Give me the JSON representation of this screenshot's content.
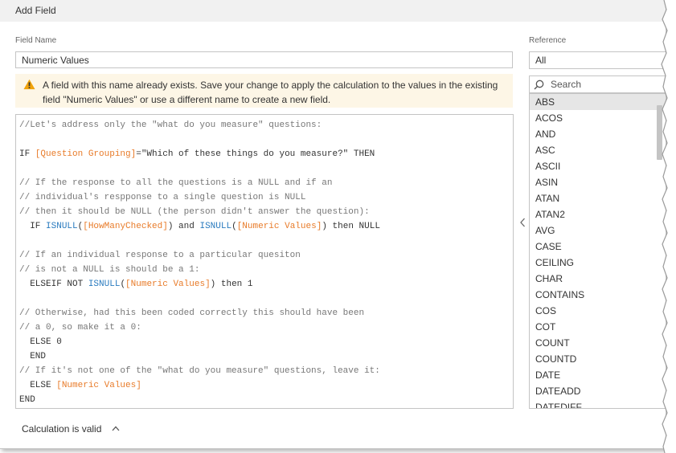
{
  "dialog": {
    "title": "Add Field"
  },
  "field_name": {
    "label": "Field Name",
    "value": "Numeric Values"
  },
  "warning": {
    "icon": "warning-triangle-icon",
    "text": "A field with this name already exists. Save your change to apply the calculation to the values in the existing field \"Numeric Values\" or use a different name to create a new field."
  },
  "editor": {
    "lines": [
      [
        {
          "t": "c",
          "s": "//Let's address only the \"what do you measure\" questions:"
        }
      ],
      [],
      [
        {
          "t": "k",
          "s": "IF "
        },
        {
          "t": "f",
          "s": "[Question Grouping]"
        },
        {
          "t": "k",
          "s": "=\"Which of these things do you measure?\" THEN"
        }
      ],
      [],
      [
        {
          "t": "c",
          "s": "// If the response to all the questions is a NULL and if an"
        }
      ],
      [
        {
          "t": "c",
          "s": "// individual's respponse to a single question is NULL"
        }
      ],
      [
        {
          "t": "c",
          "s": "// then it should be NULL (the person didn't answer the question):"
        }
      ],
      [
        {
          "t": "k",
          "s": "  IF "
        },
        {
          "t": "u",
          "s": "ISNULL"
        },
        {
          "t": "k",
          "s": "("
        },
        {
          "t": "f",
          "s": "[HowManyChecked]"
        },
        {
          "t": "k",
          "s": ") and "
        },
        {
          "t": "u",
          "s": "ISNULL"
        },
        {
          "t": "k",
          "s": "("
        },
        {
          "t": "f",
          "s": "[Numeric Values]"
        },
        {
          "t": "k",
          "s": ") then NULL"
        }
      ],
      [],
      [
        {
          "t": "c",
          "s": "// If an individual response to a particular quesiton"
        }
      ],
      [
        {
          "t": "c",
          "s": "// is not a NULL is should be a 1:"
        }
      ],
      [
        {
          "t": "k",
          "s": "  ELSEIF NOT "
        },
        {
          "t": "u",
          "s": "ISNULL"
        },
        {
          "t": "k",
          "s": "("
        },
        {
          "t": "f",
          "s": "[Numeric Values]"
        },
        {
          "t": "k",
          "s": ") then 1"
        }
      ],
      [],
      [
        {
          "t": "c",
          "s": "// Otherwise, had this been coded correctly this should have been"
        }
      ],
      [
        {
          "t": "c",
          "s": "// a 0, so make it a 0:"
        }
      ],
      [
        {
          "t": "k",
          "s": "  ELSE 0"
        }
      ],
      [
        {
          "t": "k",
          "s": "  END"
        }
      ],
      [
        {
          "t": "c",
          "s": "// If it's not one of the \"what do you measure\" questions, leave it:"
        }
      ],
      [
        {
          "t": "k",
          "s": "  ELSE "
        },
        {
          "t": "f",
          "s": "[Numeric Values]"
        }
      ],
      [
        {
          "t": "k",
          "s": "END"
        }
      ]
    ]
  },
  "reference": {
    "label": "Reference",
    "selected": "All",
    "search_placeholder": "Search",
    "functions": [
      "ABS",
      "ACOS",
      "AND",
      "ASC",
      "ASCII",
      "ASIN",
      "ATAN",
      "ATAN2",
      "AVG",
      "CASE",
      "CEILING",
      "CHAR",
      "CONTAINS",
      "COS",
      "COT",
      "COUNT",
      "COUNTD",
      "DATE",
      "DATEADD",
      "DATEDIFF"
    ],
    "selected_function": "ABS"
  },
  "status": {
    "text": "Calculation is valid"
  },
  "colors": {
    "field": "#e87b29",
    "function": "#2a7bbf",
    "comment": "#777777",
    "warning_bg": "#fdf6e6",
    "warning_icon": "#f0a20a"
  }
}
